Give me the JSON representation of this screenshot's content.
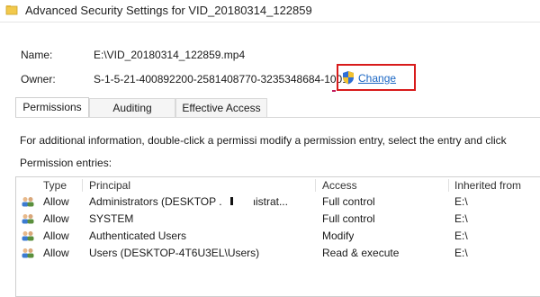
{
  "window": {
    "title": "Advanced Security Settings for VID_20180314_122859"
  },
  "name_row": {
    "label": "Name:",
    "value": "E:\\VID_20180314_122859.mp4"
  },
  "owner_row": {
    "label": "Owner:",
    "value": "S-1-5-21-400892200-2581408770-3235348684-1001",
    "change_link": "Change"
  },
  "tabs": [
    {
      "label": "Permissions",
      "selected": true
    },
    {
      "label": "Auditing",
      "selected": false
    },
    {
      "label": "Effective Access",
      "selected": false
    }
  ],
  "info_text": "For additional information, double-click a permissi                       modify a permission entry, select the entry and click",
  "entries_label": "Permission entries:",
  "table": {
    "headers": [
      "Type",
      "Principal",
      "Access",
      "Inherited from"
    ],
    "rows": [
      {
        "icon": "user-group-icon",
        "type": "Allow",
        "principal": "Administrators (DESKTOP            .\\Administrat...",
        "access": "Full control",
        "inherited": "E:\\"
      },
      {
        "icon": "user-group-icon",
        "type": "Allow",
        "principal": "SYSTEM",
        "access": "Full control",
        "inherited": "E:\\"
      },
      {
        "icon": "user-group-icon",
        "type": "Allow",
        "principal": "Authenticated Users",
        "access": "Modify",
        "inherited": "E:\\"
      },
      {
        "icon": "user-group-icon",
        "type": "Allow",
        "principal": "Users (DESKTOP-4T6U3EL\\Users)",
        "access": "Read & execute",
        "inherited": "E:\\"
      }
    ]
  },
  "colors": {
    "highlight_box": "#d81b1b",
    "link": "#1a66c4",
    "border": "#cfcfcf"
  }
}
